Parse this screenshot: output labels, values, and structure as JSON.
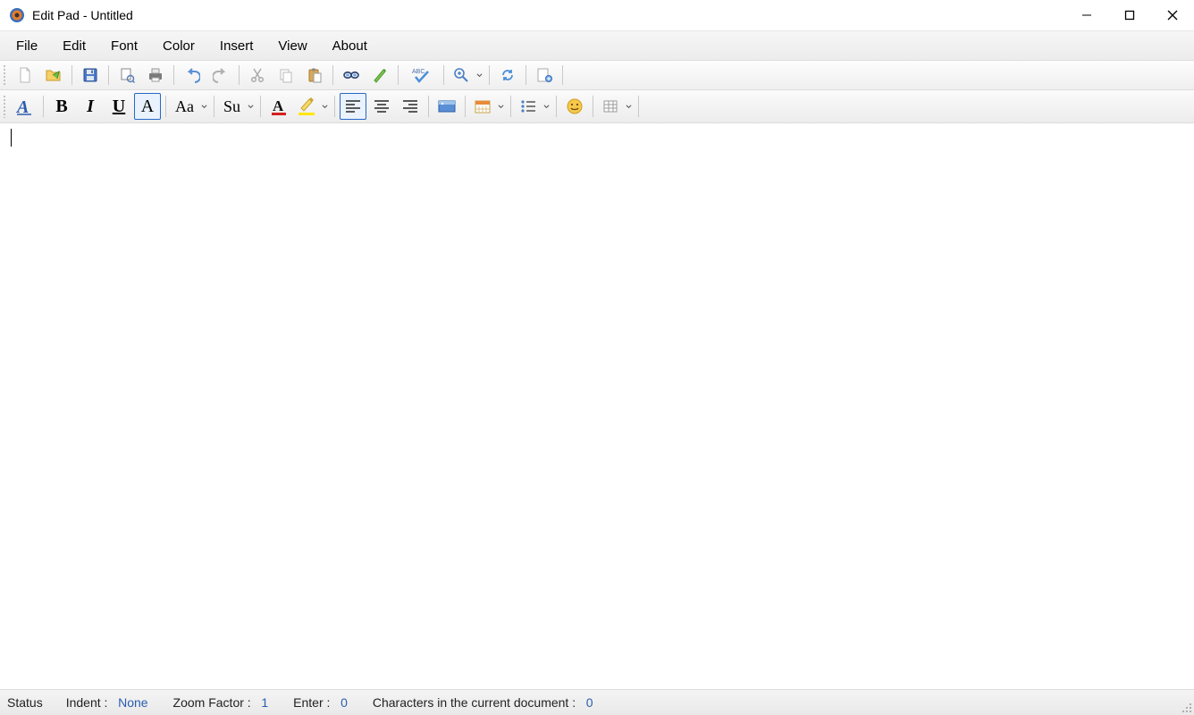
{
  "window": {
    "title": "Edit Pad - Untitled"
  },
  "menu": {
    "items": [
      "File",
      "Edit",
      "Font",
      "Color",
      "Insert",
      "View",
      "About"
    ]
  },
  "toolbar1": {
    "new": "new-file-icon",
    "open": "open-file-icon",
    "save": "save-icon",
    "print_preview": "print-preview-icon",
    "print": "print-icon",
    "undo": "undo-icon",
    "redo": "redo-icon",
    "cut": "cut-icon",
    "copy": "copy-icon",
    "paste": "paste-icon",
    "find": "find-icon",
    "highlight_pen": "highlight-pen-icon",
    "spellcheck": "spellcheck-icon",
    "zoom": "zoom-icon",
    "refresh": "refresh-icon",
    "page_setup": "page-setup-icon"
  },
  "toolbar2": {
    "font_style": "font-style-icon",
    "bold": "B",
    "italic": "I",
    "underline": "U",
    "clear_format": "A",
    "case": "Aa",
    "super_sub": "Su",
    "font_color": "font-color-icon",
    "highlight_color": "highlight-color-icon",
    "align_left": "align-left-icon",
    "align_center": "align-center-icon",
    "align_right": "align-right-icon",
    "insert_image": "insert-image-icon",
    "insert_date": "insert-date-icon",
    "bullets": "bullets-icon",
    "emoji": "emoji-icon",
    "insert_table": "insert-table-icon"
  },
  "status": {
    "status_label": "Status",
    "indent_label": "Indent :",
    "indent_value": "None",
    "zoom_label": "Zoom Factor :",
    "zoom_value": "1",
    "enter_label": "Enter :",
    "enter_value": "0",
    "chars_label": "Characters in the current document :",
    "chars_value": "0"
  }
}
